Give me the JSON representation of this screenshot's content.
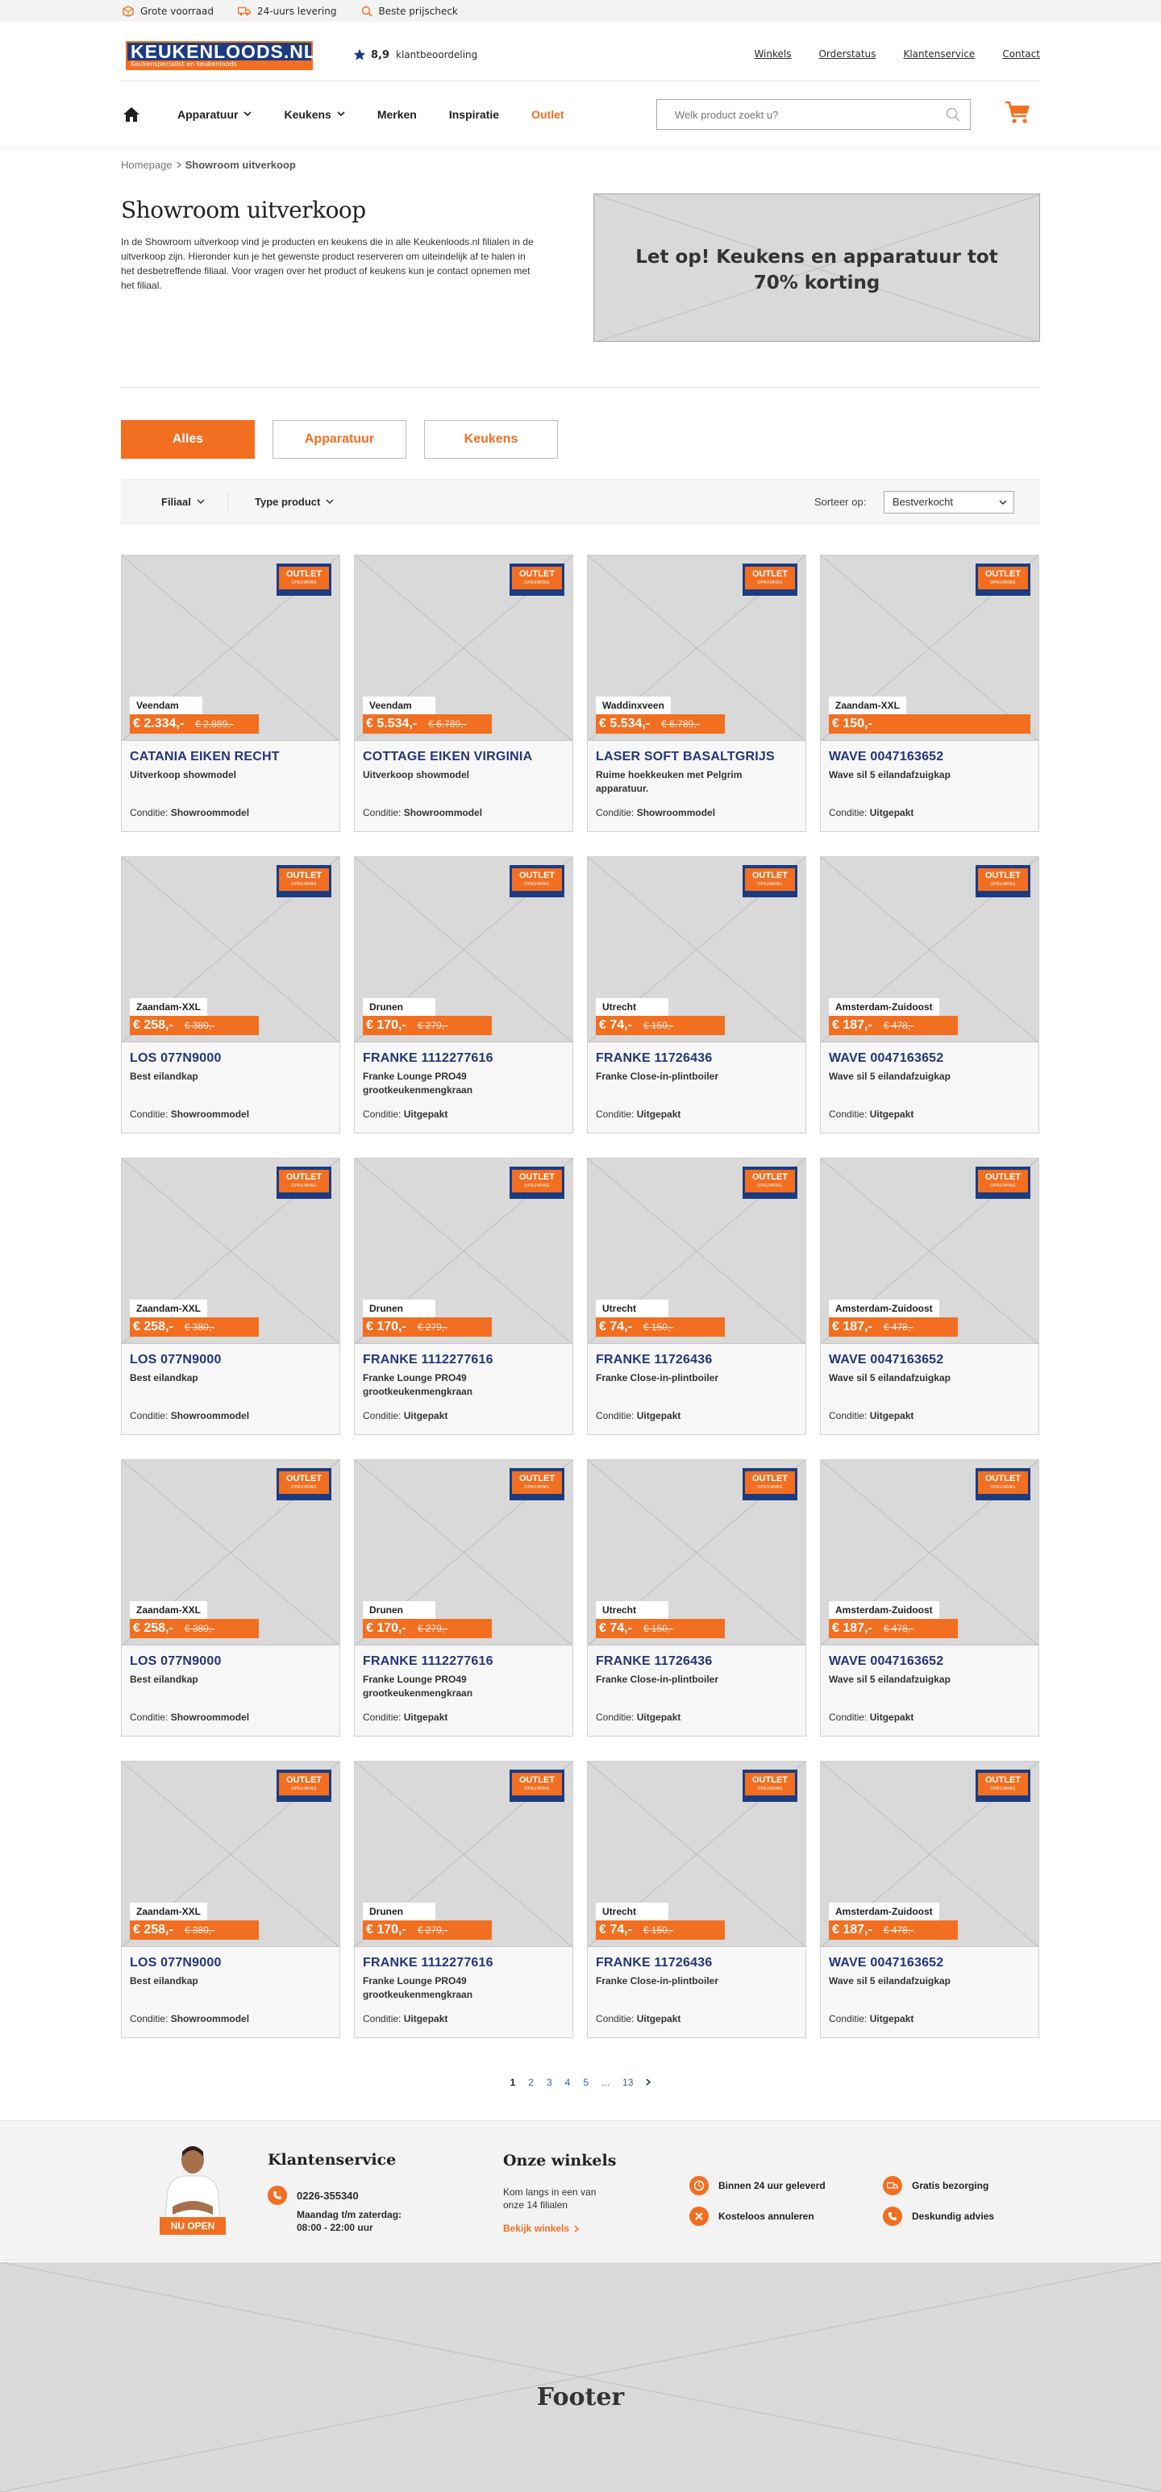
{
  "usp_bar": {
    "items": [
      {
        "label": "Grote voorraad",
        "icon": "box-icon"
      },
      {
        "label": "24-uurs levering",
        "icon": "truck-icon"
      },
      {
        "label": "Beste prijscheck",
        "icon": "search-check-icon"
      }
    ]
  },
  "header": {
    "logo_text": "KEUKENLOODS.NL",
    "logo_tagline": "Keukenspecialist en keukenloods",
    "rating_score": "8,9",
    "rating_label": "klantbeoordeling",
    "links": [
      "Winkels",
      "Orderstatus",
      "Klantenservice",
      "Contact"
    ]
  },
  "nav": {
    "items": [
      {
        "label": "Apparatuur",
        "has_dropdown": true
      },
      {
        "label": "Keukens",
        "has_dropdown": true
      },
      {
        "label": "Merken",
        "has_dropdown": false
      },
      {
        "label": "Inspiratie",
        "has_dropdown": false
      },
      {
        "label": "Outlet",
        "has_dropdown": false
      }
    ],
    "search_placeholder": "Welk product zoekt u?"
  },
  "breadcrumb": {
    "home": "Homepage",
    "current": "Showroom uitverkoop"
  },
  "intro": {
    "title": "Showroom uitverkoop",
    "text": "In de Showroom uitverkoop vind je producten en keukens die in alle Keukenloods.nl filialen in de uitverkoop zijn. Hieronder kun je het gewenste product reserveren om uiteindelijk af te halen in het desbetreffende filiaal. Voor vragen over het product of keukens kun je contact opnemen met het filiaal.",
    "promo_line1": "Let op! Keukens en apparatuur tot",
    "promo_line2": "70% korting"
  },
  "tabs": [
    {
      "label": "Alles",
      "active": true
    },
    {
      "label": "Apparatuur",
      "active": false
    },
    {
      "label": "Keukens",
      "active": false
    }
  ],
  "filters": {
    "filiaal": "Filiaal",
    "type": "Type product",
    "sort_label": "Sorteer op:",
    "sort_value": "Bestverkocht"
  },
  "badge": {
    "line1": "OUTLET",
    "line2": "OPRUIMING"
  },
  "condition_label": "Conditie:",
  "products": [
    {
      "location": "Veendam",
      "price": "€ 2.334,-",
      "old_price": "€ 2.889,-",
      "title": "CATANIA EIKEN RECHT",
      "subtitle": "Uitverkoop showmodel",
      "condition": "Showroommodel"
    },
    {
      "location": "Veendam",
      "price": "€ 5.534,-",
      "old_price": "€ 6.789,-",
      "title": "COTTAGE EIKEN VIRGINIA",
      "subtitle": "Uitverkoop showmodel",
      "condition": "Showroommodel"
    },
    {
      "location": "Waddinxveen",
      "price": "€ 5.534,-",
      "old_price": "€ 6.789,-",
      "title": "LASER SOFT BASALTGRIJS",
      "subtitle": "Ruime hoekkeuken met Pelgrim apparatuur.",
      "condition": "Showroommodel"
    },
    {
      "location": "Zaandam-XXL",
      "price": "€ 150,-",
      "old_price": "",
      "title": "WAVE 0047163652",
      "subtitle": "Wave sil 5 eilandafzuigkap",
      "condition": "Uitgepakt"
    },
    {
      "location": "Zaandam-XXL",
      "price": "€ 258,-",
      "old_price": "€ 380,-",
      "title": "LOS 077N9000",
      "subtitle": "Best eilandkap",
      "condition": "Showroommodel"
    },
    {
      "location": "Drunen",
      "price": "€ 170,-",
      "old_price": "€ 279,-",
      "title": "FRANKE 1112277616",
      "subtitle": "Franke Lounge PRO49 grootkeukenmengkraan",
      "condition": "Uitgepakt"
    },
    {
      "location": "Utrecht",
      "price": "€ 74,-",
      "old_price": "€ 150,-",
      "title": "FRANKE 11726436",
      "subtitle": "Franke Close-in-plintboiler",
      "condition": "Uitgepakt"
    },
    {
      "location": "Amsterdam-Zuidoost",
      "price": "€ 187,-",
      "old_price": "€ 478,-",
      "title": "WAVE 0047163652",
      "subtitle": "Wave sil 5 eilandafzuigkap",
      "condition": "Uitgepakt"
    },
    {
      "location": "Zaandam-XXL",
      "price": "€ 258,-",
      "old_price": "€ 380,-",
      "title": "LOS 077N9000",
      "subtitle": "Best eilandkap",
      "condition": "Showroommodel"
    },
    {
      "location": "Drunen",
      "price": "€ 170,-",
      "old_price": "€ 279,-",
      "title": "FRANKE 1112277616",
      "subtitle": "Franke Lounge PRO49 grootkeukenmengkraan",
      "condition": "Uitgepakt"
    },
    {
      "location": "Utrecht",
      "price": "€ 74,-",
      "old_price": "€ 150,-",
      "title": "FRANKE 11726436",
      "subtitle": "Franke Close-in-plintboiler",
      "condition": "Uitgepakt"
    },
    {
      "location": "Amsterdam-Zuidoost",
      "price": "€ 187,-",
      "old_price": "€ 478,-",
      "title": "WAVE 0047163652",
      "subtitle": "Wave sil 5 eilandafzuigkap",
      "condition": "Uitgepakt"
    },
    {
      "location": "Zaandam-XXL",
      "price": "€ 258,-",
      "old_price": "€ 380,-",
      "title": "LOS 077N9000",
      "subtitle": "Best eilandkap",
      "condition": "Showroommodel"
    },
    {
      "location": "Drunen",
      "price": "€ 170,-",
      "old_price": "€ 279,-",
      "title": "FRANKE 1112277616",
      "subtitle": "Franke Lounge PRO49 grootkeukenmengkraan",
      "condition": "Uitgepakt"
    },
    {
      "location": "Utrecht",
      "price": "€ 74,-",
      "old_price": "€ 150,-",
      "title": "FRANKE 11726436",
      "subtitle": "Franke Close-in-plintboiler",
      "condition": "Uitgepakt"
    },
    {
      "location": "Amsterdam-Zuidoost",
      "price": "€ 187,-",
      "old_price": "€ 478,-",
      "title": "WAVE 0047163652",
      "subtitle": "Wave sil 5 eilandafzuigkap",
      "condition": "Uitgepakt"
    },
    {
      "location": "Zaandam-XXL",
      "price": "€ 258,-",
      "old_price": "€ 380,-",
      "title": "LOS 077N9000",
      "subtitle": "Best eilandkap",
      "condition": "Showroommodel"
    },
    {
      "location": "Drunen",
      "price": "€ 170,-",
      "old_price": "€ 279,-",
      "title": "FRANKE 1112277616",
      "subtitle": "Franke Lounge PRO49 grootkeukenmengkraan",
      "condition": "Uitgepakt"
    },
    {
      "location": "Utrecht",
      "price": "€ 74,-",
      "old_price": "€ 150,-",
      "title": "FRANKE 11726436",
      "subtitle": "Franke Close-in-plintboiler",
      "condition": "Uitgepakt"
    },
    {
      "location": "Amsterdam-Zuidoost",
      "price": "€ 187,-",
      "old_price": "€ 478,-",
      "title": "WAVE 0047163652",
      "subtitle": "Wave sil 5 eilandafzuigkap",
      "condition": "Uitgepakt"
    }
  ],
  "pagination": {
    "pages": [
      "1",
      "2",
      "3",
      "4",
      "5",
      "...",
      "13"
    ],
    "current": "1"
  },
  "service": {
    "badge": "NU OPEN",
    "title": "Klantenservice",
    "phone": "0226-355340",
    "hours_line1": "Maandag t/m zaterdag:",
    "hours_line2": "08:00 - 22:00 uur",
    "stores_title": "Onze winkels",
    "stores_text": "Kom langs in een van onze 14 filialen",
    "stores_link": "Bekijk winkels",
    "usps": [
      {
        "label": "Binnen 24 uur geleverd",
        "icon": "clock-24-icon"
      },
      {
        "label": "Gratis bezorging",
        "icon": "truck-icon"
      },
      {
        "label": "Kosteloos annuleren",
        "icon": "cancel-icon"
      },
      {
        "label": "Deskundig advies",
        "icon": "phone-icon"
      }
    ]
  },
  "footer": {
    "label": "Footer"
  },
  "colors": {
    "accent": "#f26f21",
    "brand_blue": "#1c3c82",
    "title_blue": "#24357a"
  }
}
